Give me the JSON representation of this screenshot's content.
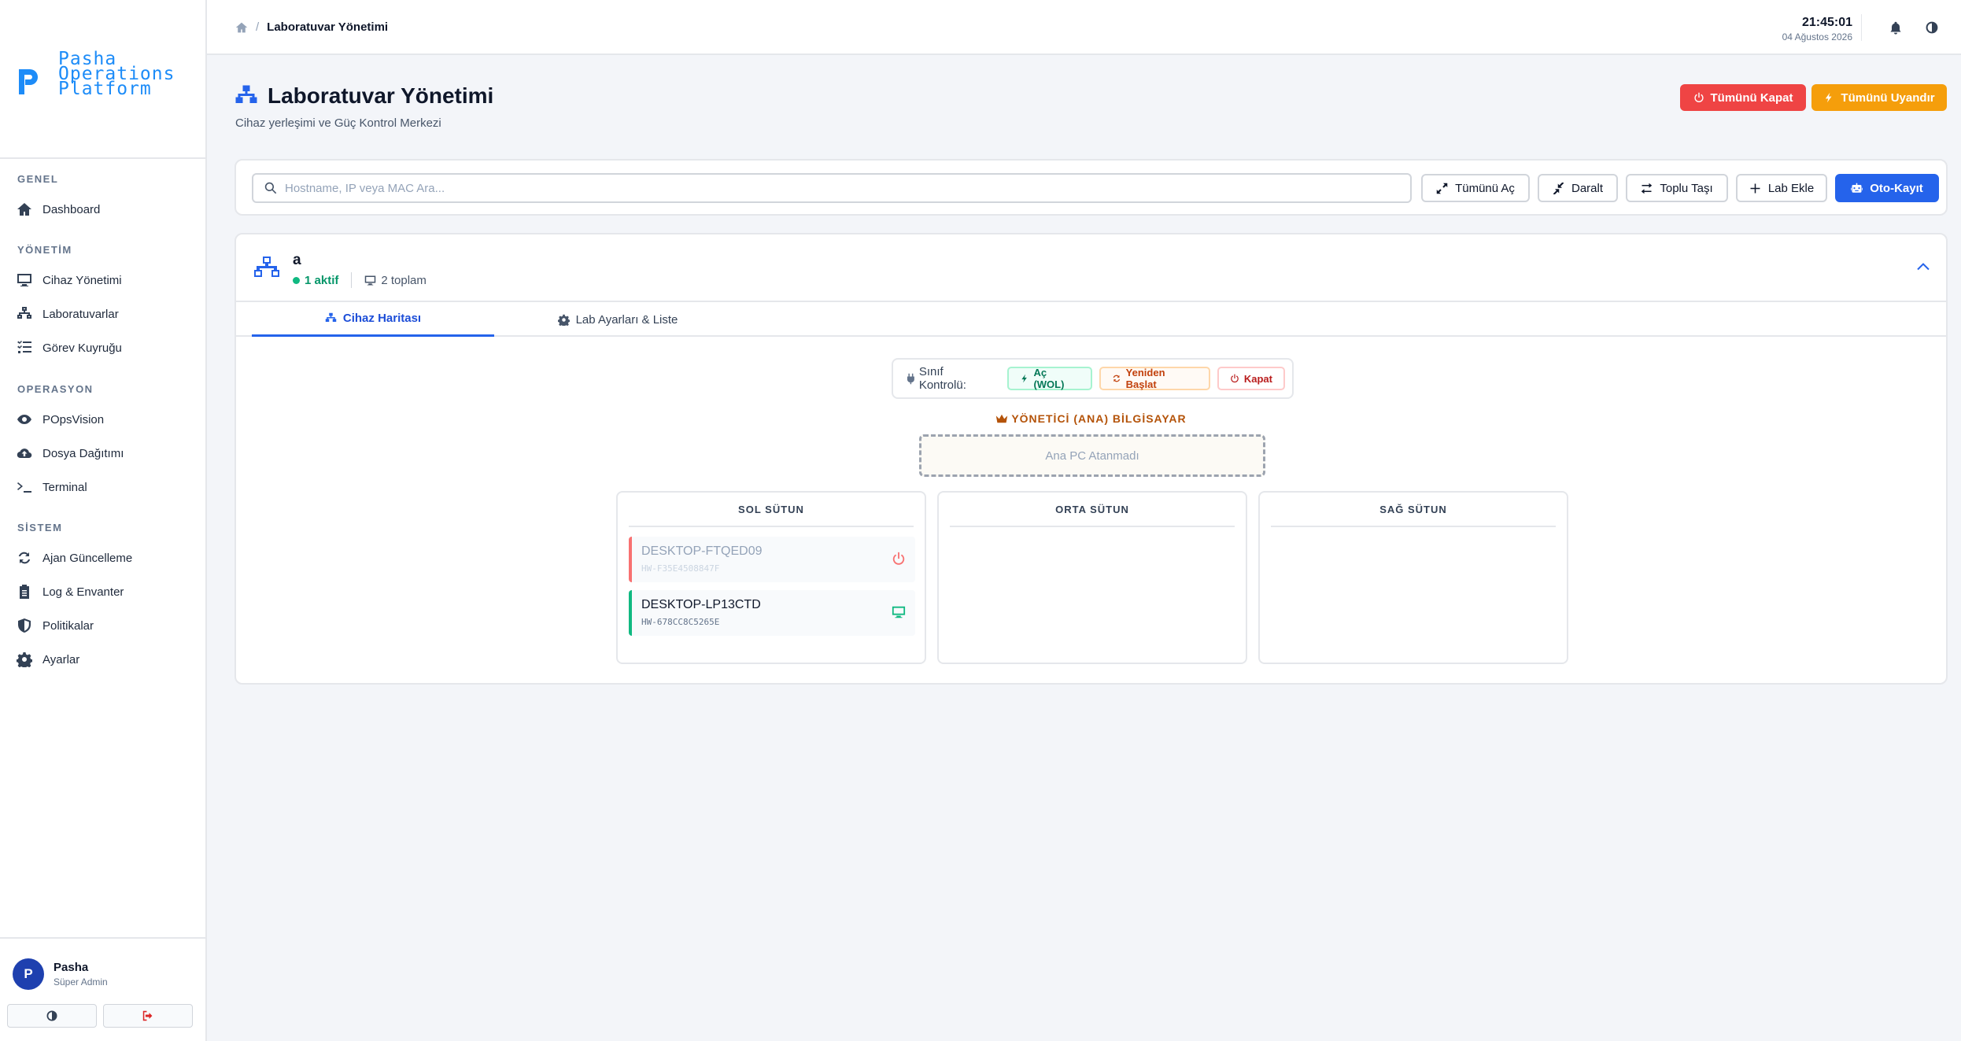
{
  "app": {
    "logo_lines": [
      "Pasha",
      "Operations",
      "Platform"
    ]
  },
  "sidebar": {
    "sections": [
      {
        "title": "GENEL",
        "items": [
          {
            "label": "Dashboard",
            "icon": "home-icon"
          }
        ]
      },
      {
        "title": "YÖNETİM",
        "items": [
          {
            "label": "Cihaz Yönetimi",
            "icon": "monitor-icon"
          },
          {
            "label": "Laboratuvarlar",
            "icon": "network-icon"
          },
          {
            "label": "Görev Kuyruğu",
            "icon": "list-check-icon"
          }
        ]
      },
      {
        "title": "OPERASYON",
        "items": [
          {
            "label": "POpsVision",
            "icon": "eye-icon"
          },
          {
            "label": "Dosya Dağıtımı",
            "icon": "cloud-upload-icon"
          },
          {
            "label": "Terminal",
            "icon": "terminal-icon"
          }
        ]
      },
      {
        "title": "SİSTEM",
        "items": [
          {
            "label": "Ajan Güncelleme",
            "icon": "sync-icon"
          },
          {
            "label": "Log & Envanter",
            "icon": "clipboard-icon"
          },
          {
            "label": "Politikalar",
            "icon": "shield-icon"
          },
          {
            "label": "Ayarlar",
            "icon": "gear-icon"
          }
        ]
      }
    ],
    "user": {
      "initial": "P",
      "name": "Pasha",
      "role": "Süper Admin"
    }
  },
  "topbar": {
    "breadcrumb_current": "Laboratuvar Yönetimi",
    "breadcrumb_sep": "/",
    "time": "21:45:01",
    "date": "04 Ağustos 2026"
  },
  "header": {
    "title": "Laboratuvar Yönetimi",
    "subtitle": "Cihaz yerleşimi ve Güç Kontrol Merkezi",
    "shutdown_all": "Tümünü Kapat",
    "wake_all": "Tümünü Uyandır"
  },
  "toolbar": {
    "search_placeholder": "Hostname, IP veya MAC Ara...",
    "expand_all": "Tümünü Aç",
    "collapse": "Daralt",
    "bulk_move": "Toplu Taşı",
    "add_lab": "Lab Ekle",
    "auto_register": "Oto-Kayıt"
  },
  "lab": {
    "name": "a",
    "active": "1 aktif",
    "total": "2 toplam",
    "tabs": {
      "map": "Cihaz Haritası",
      "settings": "Lab Ayarları & Liste"
    },
    "class_control": {
      "label": "Sınıf Kontrolü:",
      "wol": "Aç (WOL)",
      "restart": "Yeniden Başlat",
      "off": "Kapat"
    },
    "admin_title": "YÖNETİCİ (ANA) BİLGİSAYAR",
    "admin_empty": "Ana PC Atanmadı",
    "columns": {
      "left": "SOL SÜTUN",
      "middle": "ORTA SÜTUN",
      "right": "SAĞ SÜTUN"
    },
    "devices": [
      {
        "hostname": "DESKTOP-FTQED09",
        "hwid": "HW-F35E4508847F",
        "status": "offline"
      },
      {
        "hostname": "DESKTOP-LP13CTD",
        "hwid": "HW-678CC8C5265E",
        "status": "online"
      }
    ]
  },
  "colors": {
    "primary": "#2563eb",
    "danger": "#ef4444",
    "warning": "#f59e0b",
    "success": "#10b981"
  }
}
